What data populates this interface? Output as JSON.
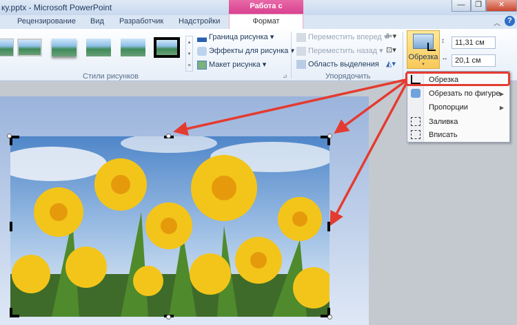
{
  "window": {
    "title": "ку.pptx - Microsoft PowerPoint",
    "context_tab": "Работа с рисунками",
    "minimize": "—",
    "maximize": "❐",
    "close": "✕"
  },
  "tabs": [
    {
      "label": "Рецензирование"
    },
    {
      "label": "Вид"
    },
    {
      "label": "Разработчик"
    },
    {
      "label": "Надстройки"
    },
    {
      "label": "Формат"
    }
  ],
  "ribbon": {
    "styles_group": "Стили рисунков",
    "border": "Граница рисунка ▾",
    "effects": "Эффекты для рисунка ▾",
    "layout": "Макет рисунка ▾",
    "arrange_group": "Упорядочить",
    "forward": "Переместить вперед ▾",
    "backward": "Переместить назад ▾",
    "selection": "Область выделения",
    "crop": "Обрезка",
    "height": "11,31 см",
    "width": "20,1 см"
  },
  "menu": {
    "items": [
      {
        "label": "Обрезка"
      },
      {
        "label": "Обрезать по фигуре",
        "sub": true
      },
      {
        "label": "Пропорции",
        "sub": true
      },
      {
        "label": "Заливка"
      },
      {
        "label": "Вписать"
      }
    ]
  },
  "colors": {
    "accent": "#e43b30",
    "crop_bg": "#f8c858",
    "context": "#d9418f"
  }
}
